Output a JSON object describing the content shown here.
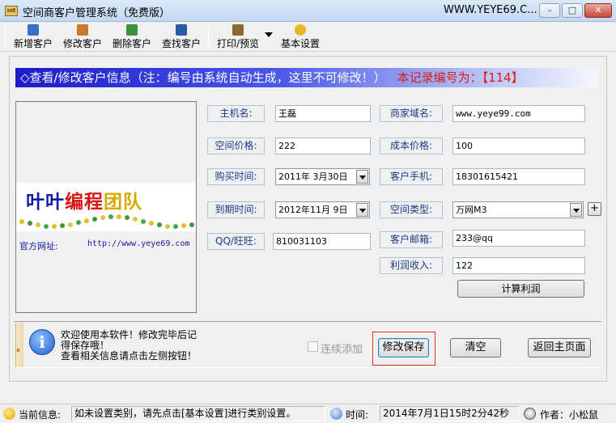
{
  "window": {
    "title": "空间商客户管理系统（免费版）",
    "url_text": "WWW.YEYE69.C...",
    "app_icon_text": "ıııt",
    "min_glyph": "–",
    "max_glyph": "□",
    "close_glyph": "✕"
  },
  "toolbar": {
    "items": [
      {
        "label": "新增客户",
        "icon": "add-customer-icon",
        "color": "#3a6fc8"
      },
      {
        "label": "修改客户",
        "icon": "edit-customer-icon",
        "color": "#c87a2a"
      },
      {
        "label": "删除客户",
        "icon": "delete-customer-icon",
        "color": "#3f8f3f"
      },
      {
        "label": "查找客户",
        "icon": "find-customer-icon",
        "color": "#2a5aa8"
      },
      {
        "label": "打印/预览",
        "icon": "print-icon",
        "color": "#8a6a30"
      },
      {
        "label": "基本设置",
        "icon": "settings-smiley-icon",
        "color": "#e8b820"
      }
    ]
  },
  "header": {
    "text": "◇查看/修改客户信息（注：编号由系统自动生成，这里不可修改！）",
    "record": "本记录编号为：【114】"
  },
  "banner": {
    "logo_parts": [
      "叶叶",
      "编程",
      "团队"
    ],
    "site_label": "官方网址:",
    "site_url": "http://www.yeye69.com"
  },
  "form": {
    "host_name": {
      "label": "主机名:",
      "value": "王磊"
    },
    "domain": {
      "label": "商家域名:",
      "value": "www.yeye99.com"
    },
    "space_price": {
      "label": "空间价格:",
      "value": "222"
    },
    "cost_price": {
      "label": "成本价格:",
      "value": "100"
    },
    "buy_date": {
      "label": "购买时间:",
      "value": "2011年 3月30日"
    },
    "phone": {
      "label": "客户手机:",
      "value": "18301615421"
    },
    "expire_date": {
      "label": "到期时间:",
      "value": "2012年11月 9日"
    },
    "space_type": {
      "label": "空间类型:",
      "value": "万网M3"
    },
    "qq": {
      "label": "QQ/旺旺:",
      "value": "810031103"
    },
    "email": {
      "label": "客户邮箱:",
      "value": "233@qq"
    },
    "profit": {
      "label": "利润收入:",
      "value": "122"
    },
    "add_type_label": "+",
    "calc_label": "计算利润"
  },
  "tip": {
    "lines": [
      "欢迎使用本软件！修改完毕后记",
      "得保存哦！",
      "查看相关信息请点击左侧按钮！"
    ]
  },
  "actions": {
    "continuous_label": "连续添加",
    "save_label": "修改保存",
    "clear_label": "清空",
    "home_label": "返回主页面"
  },
  "status": {
    "current_label": "当前信息:",
    "current_message": "如未设置类别，请先点击[基本设置]进行类别设置。",
    "time_label": "时间:",
    "time_value": "2014年7月1日15时2分42秒",
    "author_label": "作者：小松鼠"
  }
}
